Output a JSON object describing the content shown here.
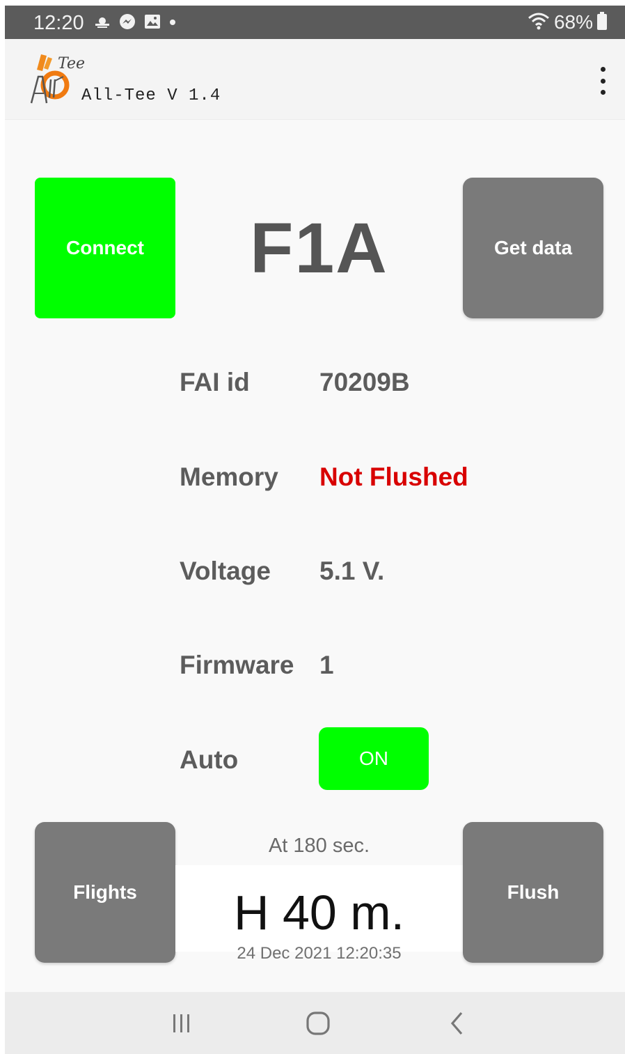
{
  "status_bar": {
    "time": "12:20",
    "battery_percent": "68%",
    "icons": [
      "weather-icon",
      "messenger-icon",
      "gallery-icon",
      "notification-dot-icon",
      "wifi-icon",
      "battery-icon"
    ]
  },
  "app_bar": {
    "title": "All-Tee V 1.4",
    "logo_text": "All-Tee"
  },
  "buttons": {
    "connect": "Connect",
    "get_data": "Get data",
    "flights": "Flights",
    "flush": "Flush"
  },
  "model": "F1A",
  "info": {
    "fai_id": {
      "label": "FAI id",
      "value": "70209B"
    },
    "memory": {
      "label": "Memory",
      "value": "Not Flushed"
    },
    "voltage": {
      "label": "Voltage",
      "value": "5.1 V."
    },
    "firmware": {
      "label": "Firmware",
      "value": "1"
    },
    "auto": {
      "label": "Auto",
      "value": "ON"
    }
  },
  "reading": {
    "caption": "At 180 sec.",
    "value": "H 40 m.",
    "timestamp": "24 Dec 2021 12:20:35"
  },
  "colors": {
    "accent_green": "#00ff00",
    "button_gray": "#7a7a7a",
    "warning_red": "#d80000",
    "status_bar": "#5b5b5b"
  }
}
